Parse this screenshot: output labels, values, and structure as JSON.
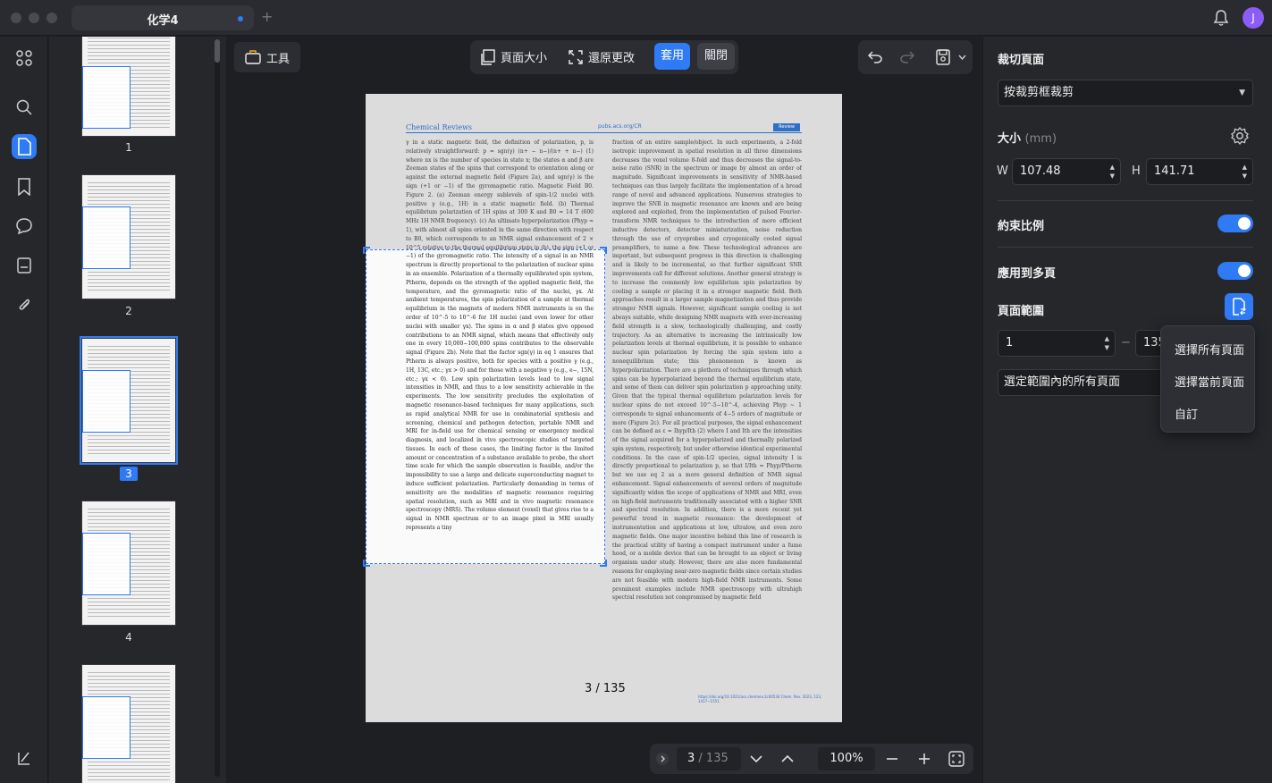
{
  "window": {
    "tab_title": "化学4",
    "new_tab": "+",
    "avatar_letter": "J"
  },
  "thumbnails": [
    {
      "label": "1"
    },
    {
      "label": "2"
    },
    {
      "label": "3",
      "selected": true
    },
    {
      "label": "4"
    }
  ],
  "toolbar": {
    "tools_label": "工具",
    "page_size_label": "頁面大小",
    "revert_label": "還原更改",
    "apply_label": "套用",
    "close_label": "關閉"
  },
  "document": {
    "journal": "Chemical Reviews",
    "url": "pubs.acs.org/CR",
    "tag": "Review",
    "page_indicator": "3 / 135",
    "left_text": "γ in a static magnetic field, the definition of polarization, p, is relatively straightforward: p = sgn(γ) (n+ − n−)/(n+ + n−) (1) where nx is the number of species in state x; the states α and β are Zeeman states of the spins that correspond to orientation along or against the external magnetic field (Figure 2a), and sgn(γ) is the sign (+1 or −1) of the gyromagnetic ratio. Magnetic Field B0. Figure 2. (a) Zeeman energy sublevels of spin-1/2 nuclei with positive γ (e.g., 1H) in a static magnetic field. (b) Thermal equilibrium polarization of 1H spins at 300 K and B0 = 14 T (600 MHz 1H NMR frequency). (c) An ultimate hyperpolarization (Phyp ≈ 1), with almost all spins oriented in the same direction with respect to B0, which corresponds to an NMR signal enhancement of 2 × 10^5 relative to the thermal equilibrium state in (b). the sign (+1 or −1) of the gyromagnetic ratio. The intensity of a signal in an NMR spectrum is directly proportional to the polarization of nuclear spins in an ensemble. Polarization of a thermally equilibrated spin system, Ptherm, depends on the strength of the applied magnetic field, the temperature, and the gyromagnetic ratio of the nuclei, γx. At ambient temperatures, the spin polarization of a sample at thermal equilibrium in the magnets of modern NMR instruments is on the order of 10^-5 to 10^-6 for 1H nuclei (and even lower for other nuclei with smaller γx). The spins in α and β states give opposed contributions to an NMR signal, which means that effectively only one in every 10,000−100,000 spins contributes to the observable signal (Figure 2b). Note that the factor sgn(γ) in eq 1 ensures that Ptherm is always positive, both for species with a positive γ (e.g., 1H, 13C, etc.; γx > 0) and for those with a negative γ (e.g., e−, 15N, etc.; γx < 0). Low spin polarization levels lead to low signal intensities in NMR, and thus to a low sensitivity achievable in the experiments. The low sensitivity precludes the exploitation of magnetic resonance-based techniques for many applications, such as rapid analytical NMR for use in combinatorial synthesis and screening, chemical and pathogen detection, portable NMR and MRI for in-field use for chemical sensing or emergency medical diagnosis, and localized in vivo spectroscopic studies of targeted tissues. In each of these cases, the limiting factor is the limited amount or concentration of a substance available to probe, the short time scale for which the sample observation is feasible, and/or the impossibility to use a large and delicate superconducting magnet to induce sufficient polarization. Particularly demanding in terms of sensitivity are the modalities of magnetic resonance requiring spatial resolution, such as MRI and in vivo magnetic resonance spectroscopy (MRS). The volume element (voxel) that gives rise to a signal in NMR spectrum or to an image pixel in MRI usually represents a tiny",
    "right_text": "fraction of an entire sample/object. In such experiments, a 2-fold isotropic improvement in spatial resolution in all three dimensions decreases the voxel volume 8-fold and thus decreases the signal-to-noise ratio (SNR) in the spectrum or image by almost an order of magnitude. Significant improvements in sensitivity of NMR-based techniques can thus largely facilitate the implementation of a broad range of novel and advanced applications. Numerous strategies to improve the SNR in magnetic resonance are known and are being explored and exploited, from the implementation of pulsed Fourier-transform NMR techniques to the introduction of more efficient inductive detectors, detector miniaturization, noise reduction through the use of cryoprobes and cryogenically cooled signal preamplifiers, to name a few. These technological advances are important, but subsequent progress in this direction is challenging and is likely to be incremental, so that further significant SNR improvements call for different solutions. Another general strategy is to increase the commonly low equilibrium spin polarization by cooling a sample or placing it in a stronger magnetic field. Both approaches result in a larger sample magnetization and thus provide stronger NMR signals. However, significant sample cooling is not always suitable, while designing NMR magnets with ever-increasing field strength is a slow, technologically challenging, and costly trajectory. As an alternative to increasing the intrinsically low polarization levels at thermal equilibrium, it is possible to enhance nuclear spin polarization by forcing the spin system into a nonequilibrium state; this phenomenon is known as hyperpolarization. There are a plethora of techniques through which spins can be hyperpolarized beyond the thermal equilibrium state, and some of them can deliver spin polarization p approaching unity. Given that the typical thermal equilibrium polarization levels for nuclear spins do not exceed 10^-5−10^-4, achieving Phyp ~ 1 corresponds to signal enhancements of 4−5 orders of magnitude or more (Figure 2c). For all practical purposes, the signal enhancement can be defined as ε = Ihyp/Ith (2) where I and Ith are the intensities of the signal acquired for a hyperpolarized and thermally polarized spin system, respectively, but under otherwise identical experimental conditions. In the case of spin-1/2 species, signal intensity I is directly proportional to polarization p, so that I/Ith = Phyp/Ptherm but we use eq 2 as a more general definition of NMR signal enhancement. Signal enhancements of several orders of magnitude significantly widen the scope of applications of NMR and MRI, even on high-field instruments traditionally associated with a higher SNR and spectral resolution. In addition, there is a more recent yet powerful trend in magnetic resonance: the development of instrumentation and applications at low, ultralow, and even zero magnetic fields. One major incentive behind this line of research is the practical utility of having a compact instrument under a fume hood, or a mobile device that can be brought to an object or living organism under study. However, there are also more fundamental reasons for employing near-zero magnetic fields since certain studies are not feasible with modern high-field NMR instruments. Some prominent examples include NMR spectroscopy with ultrahigh spectral resolution not compromised by magnetic field",
    "footer": "https://doi.org/10.1021/acs.chemrev.2c00534 Chem. Rev. 2023, 123, 1417−1551"
  },
  "bottom_nav": {
    "current_page": "3",
    "total_pages": "/ 135",
    "zoom": "100%"
  },
  "right_panel": {
    "crop_heading": "裁切頁面",
    "crop_mode": "按裁剪框裁剪",
    "size_heading": "大小",
    "size_unit": "(mm)",
    "w_label": "W",
    "w_value": "107.48",
    "h_label": "H",
    "h_value": "141.71",
    "constrain_label": "約束比例",
    "apply_multi_label": "應用到多頁",
    "range_heading": "頁面範圍",
    "range_from": "1",
    "range_dash": "−",
    "range_to": "135",
    "range_scope": "選定範圍內的所有頁面",
    "dropdown": [
      "選擇所有頁面",
      "選擇當前頁面",
      "自訂"
    ]
  },
  "colors": {
    "accent": "#2f7bf5",
    "background": "#1e1f23",
    "panel": "#26272b"
  }
}
